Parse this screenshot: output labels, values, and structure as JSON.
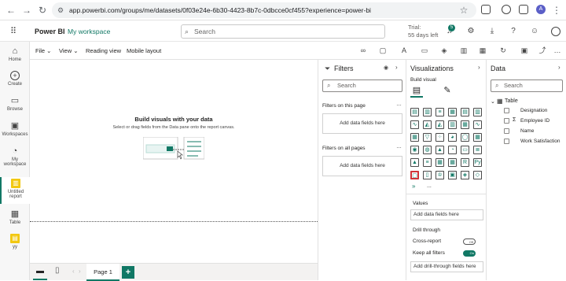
{
  "browser": {
    "url": "app.powerbi.com/groups/me/datasets/0f03e24e-6b30-4423-8b7c-0dbcce0cf455?experience=power-bi",
    "profile_initial": "A"
  },
  "appbar": {
    "brand": "Power BI",
    "workspace": "My workspace",
    "search_placeholder": "Search",
    "trial_line1": "Trial:",
    "trial_line2": "55 days left",
    "notification_count": "5"
  },
  "leftnav": {
    "items": [
      {
        "label": "Home",
        "icon": "home-icon"
      },
      {
        "label": "Create",
        "icon": "plus-icon"
      },
      {
        "label": "Browse",
        "icon": "folder-icon"
      },
      {
        "label": "Workspaces",
        "icon": "workspaces-icon"
      },
      {
        "label": "My",
        "label2": "workspace",
        "icon": "workspace-icon"
      },
      {
        "label": "Untitled",
        "label2": "report",
        "icon": "report-icon"
      },
      {
        "label": "Table",
        "icon": "table-icon"
      },
      {
        "label": "yy",
        "icon": "dataset-icon"
      }
    ]
  },
  "toolbar": {
    "file": "File",
    "view": "View",
    "reading_view": "Reading view",
    "mobile_layout": "Mobile layout"
  },
  "canvas": {
    "heading": "Build visuals with your data",
    "subtext": "Select or drag fields from the Data pane onto the report canvas."
  },
  "pages": {
    "tab": "Page 1",
    "add": "+"
  },
  "filters": {
    "title": "Filters",
    "search_placeholder": "Search",
    "on_this_page": "Filters on this page",
    "on_all_pages": "Filters on all pages",
    "add_fields": "Add data fields here"
  },
  "visualizations": {
    "title": "Visualizations",
    "build_visual": "Build visual",
    "values_label": "Values",
    "values_add": "Add data fields here",
    "drill_through": "Drill through",
    "cross_report": "Cross-report",
    "cross_report_state": "Off",
    "keep_all_filters": "Keep all filters",
    "keep_all_filters_state": "On",
    "drill_add": "Add drill-through fields here",
    "more": "..."
  },
  "data": {
    "title": "Data",
    "search_placeholder": "Search",
    "table_name": "Table",
    "fields": [
      {
        "name": "Designation",
        "sigma": ""
      },
      {
        "name": "Employee ID",
        "sigma": "Σ"
      },
      {
        "name": "Name",
        "sigma": ""
      },
      {
        "name": "Work Satisfaction",
        "sigma": ""
      }
    ]
  },
  "colors": {
    "accent": "#117865",
    "selected": "#d13438"
  }
}
